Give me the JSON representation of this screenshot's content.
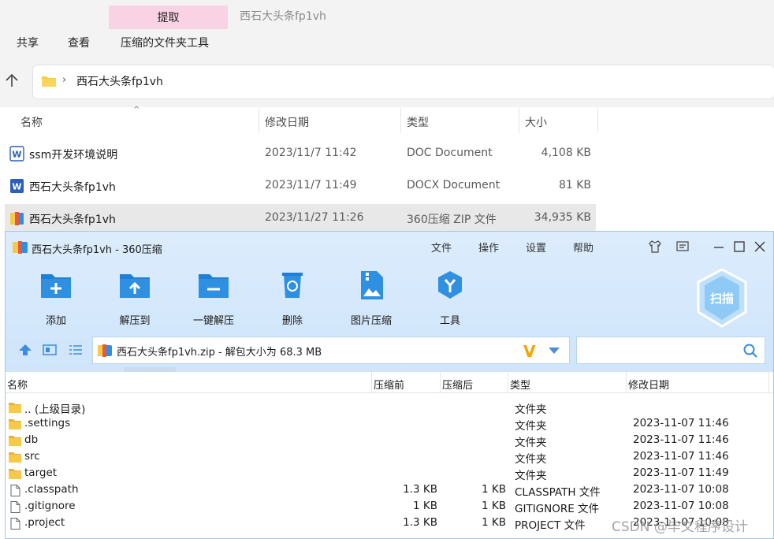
{
  "ribbon": {
    "context_tab": "提取",
    "context_title": "西石大头条fp1vh",
    "tabs": [
      "共享",
      "查看",
      "压缩的文件夹工具"
    ]
  },
  "address": {
    "path": "西石大头条fp1vh"
  },
  "explorer": {
    "columns": [
      "名称",
      "修改日期",
      "类型",
      "大小"
    ],
    "rows": [
      {
        "name": "ssm开发环境说明",
        "date": "2023/11/7 11:42",
        "type": "DOC Document",
        "size": "4,108 KB",
        "icon": "word-doc-icon"
      },
      {
        "name": "西石大头条fp1vh",
        "date": "2023/11/7 11:49",
        "type": "DOCX Document",
        "size": "81 KB",
        "icon": "word-docx-icon"
      },
      {
        "name": "西石大头条fp1vh",
        "date": "2023/11/27 11:26",
        "type": "360压缩 ZIP 文件",
        "size": "34,935 KB",
        "icon": "zip-archive-icon",
        "selected": true
      }
    ]
  },
  "zip": {
    "title": "西石大头条fp1vh - 360压缩",
    "menu": [
      "文件",
      "操作",
      "设置",
      "帮助"
    ],
    "tools": [
      {
        "label": "添加",
        "icon": "add-folder-icon"
      },
      {
        "label": "解压到",
        "icon": "extract-to-icon"
      },
      {
        "label": "一键解压",
        "icon": "one-click-extract-icon"
      },
      {
        "label": "删除",
        "icon": "recycle-bin-icon"
      },
      {
        "label": "图片压缩",
        "icon": "image-compress-icon"
      },
      {
        "label": "工具",
        "icon": "tools-icon"
      }
    ],
    "scan_label": "扫描",
    "path_text": "西石大头条fp1vh.zip - 解包大小为 68.3 MB",
    "columns": [
      "名称",
      "压缩前",
      "压缩后",
      "类型",
      "修改日期"
    ],
    "rows": [
      {
        "name": ".. (上级目录)",
        "before": "",
        "after": "",
        "type": "文件夹",
        "date": "",
        "kind": "folder"
      },
      {
        "name": ".settings",
        "before": "",
        "after": "",
        "type": "文件夹",
        "date": "2023-11-07 11:46",
        "kind": "folder"
      },
      {
        "name": "db",
        "before": "",
        "after": "",
        "type": "文件夹",
        "date": "2023-11-07 11:46",
        "kind": "folder"
      },
      {
        "name": "src",
        "before": "",
        "after": "",
        "type": "文件夹",
        "date": "2023-11-07 11:46",
        "kind": "folder"
      },
      {
        "name": "target",
        "before": "",
        "after": "",
        "type": "文件夹",
        "date": "2023-11-07 11:49",
        "kind": "folder"
      },
      {
        "name": ".classpath",
        "before": "1.3 KB",
        "after": "1 KB",
        "type": "CLASSPATH 文件",
        "date": "2023-11-07 10:08",
        "kind": "file"
      },
      {
        "name": ".gitignore",
        "before": "1 KB",
        "after": "1 KB",
        "type": "GITIGNORE 文件",
        "date": "2023-11-07 10:08",
        "kind": "file"
      },
      {
        "name": ".project",
        "before": "1.3 KB",
        "after": "1 KB",
        "type": "PROJECT 文件",
        "date": "2023-11-07 10:08",
        "kind": "file"
      }
    ]
  },
  "watermark": "CSDN @毕文程序设计",
  "colors": {
    "accent_blue": "#2f8fe0",
    "zip_bg": "#d6e9fb",
    "pink_tab": "#f9d3e4",
    "folder_yellow": "#f7c948"
  }
}
